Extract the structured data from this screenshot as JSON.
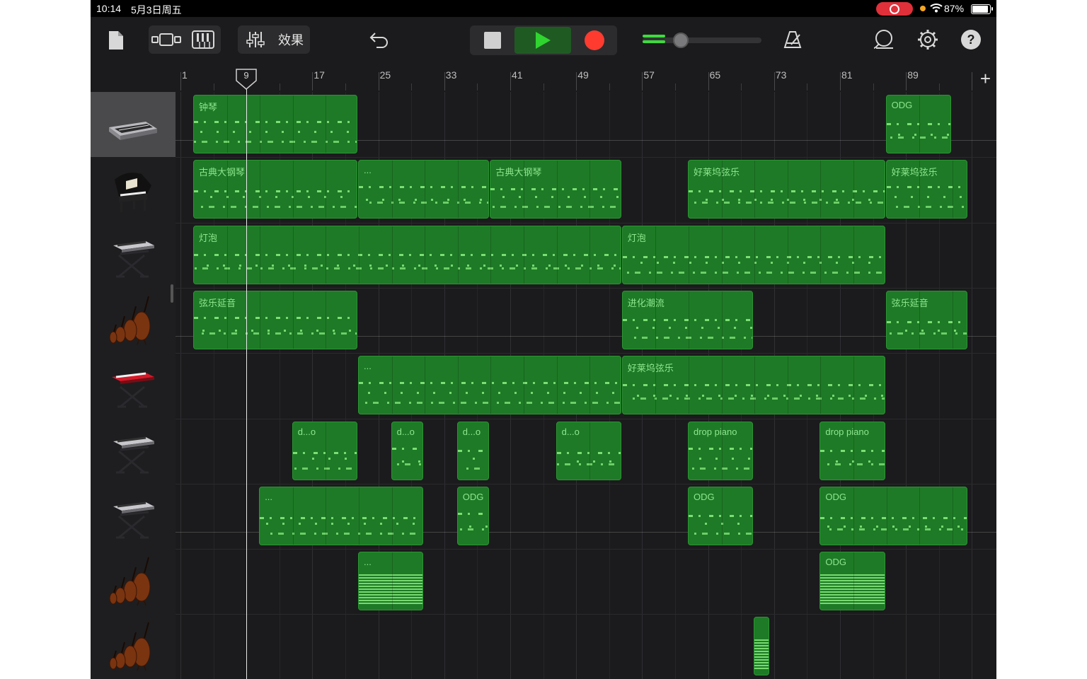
{
  "status_bar": {
    "time": "10:14",
    "date": "5月3日周五",
    "battery_percent": "87%",
    "recording_indicator_color": "#e0303a",
    "privacy_dot_color": "#f5a623"
  },
  "toolbar": {
    "icons": [
      "document-icon",
      "tracks-view-icon",
      "keyboard-icon",
      "mixer-sliders-icon",
      "undo-icon",
      "stop-icon",
      "play-icon",
      "record-icon",
      "master-volume-slider",
      "metronome-icon",
      "loop-browser-icon",
      "settings-gear-icon",
      "help-icon"
    ],
    "effects_label": "效果",
    "play_accent": "#2fd42f",
    "record_color": "#ff3b30",
    "help_glyph": "?",
    "volume_level": 0.13
  },
  "ruler": {
    "bar_numbers": [
      "1",
      "9",
      "17",
      "25",
      "33",
      "41",
      "49",
      "57",
      "65",
      "73",
      "81",
      "89"
    ],
    "add_label": "+",
    "playhead_bar": "9"
  },
  "tracks": [
    {
      "instrument": "synth-keyboard",
      "selected": true
    },
    {
      "instrument": "grand-piano"
    },
    {
      "instrument": "synth-on-stand"
    },
    {
      "instrument": "strings-ensemble"
    },
    {
      "instrument": "red-keyboard-on-stand"
    },
    {
      "instrument": "keyboard-on-stand"
    },
    {
      "instrument": "keyboard-on-stand"
    },
    {
      "instrument": "strings-ensemble"
    },
    {
      "instrument": "strings-ensemble"
    }
  ],
  "regions": [
    {
      "track": 0,
      "start": 1,
      "end": 21,
      "name": "钟琴"
    },
    {
      "track": 0,
      "start": 85,
      "end": 93,
      "name": "ODG"
    },
    {
      "track": 1,
      "start": 1,
      "end": 21,
      "name": "古典大钢琴"
    },
    {
      "track": 1,
      "start": 21,
      "end": 37,
      "name": "..."
    },
    {
      "track": 1,
      "start": 37,
      "end": 53,
      "name": "古典大钢琴"
    },
    {
      "track": 1,
      "start": 61,
      "end": 85,
      "name": "好莱坞弦乐"
    },
    {
      "track": 1,
      "start": 85,
      "end": 95,
      "name": "好莱坞弦乐"
    },
    {
      "track": 2,
      "start": 1,
      "end": 53,
      "name": "灯泡"
    },
    {
      "track": 2,
      "start": 53,
      "end": 85,
      "name": "灯泡"
    },
    {
      "track": 3,
      "start": 1,
      "end": 21,
      "name": "弦乐延音"
    },
    {
      "track": 3,
      "start": 53,
      "end": 69,
      "name": "进化潮流"
    },
    {
      "track": 3,
      "start": 85,
      "end": 95,
      "name": "弦乐延音"
    },
    {
      "track": 4,
      "start": 21,
      "end": 53,
      "name": "..."
    },
    {
      "track": 4,
      "start": 53,
      "end": 85,
      "name": "好莱坞弦乐"
    },
    {
      "track": 5,
      "start": 13,
      "end": 21,
      "name": "d...o"
    },
    {
      "track": 5,
      "start": 25,
      "end": 29,
      "name": "d...o"
    },
    {
      "track": 5,
      "start": 33,
      "end": 37,
      "name": "d...o"
    },
    {
      "track": 5,
      "start": 45,
      "end": 53,
      "name": "d...o"
    },
    {
      "track": 5,
      "start": 61,
      "end": 69,
      "name": "drop piano"
    },
    {
      "track": 5,
      "start": 77,
      "end": 85,
      "name": "drop piano"
    },
    {
      "track": 6,
      "start": 9,
      "end": 29,
      "name": "..."
    },
    {
      "track": 6,
      "start": 33,
      "end": 37,
      "name": "ODG"
    },
    {
      "track": 6,
      "start": 61,
      "end": 69,
      "name": "ODG"
    },
    {
      "track": 6,
      "start": 77,
      "end": 95,
      "name": "ODG"
    },
    {
      "track": 7,
      "start": 21,
      "end": 29,
      "name": "...",
      "dense": true
    },
    {
      "track": 7,
      "start": 77,
      "end": 85,
      "name": "ODG",
      "dense": true
    },
    {
      "track": 8,
      "start": 69,
      "end": 71,
      "name": "",
      "dense": true
    }
  ]
}
